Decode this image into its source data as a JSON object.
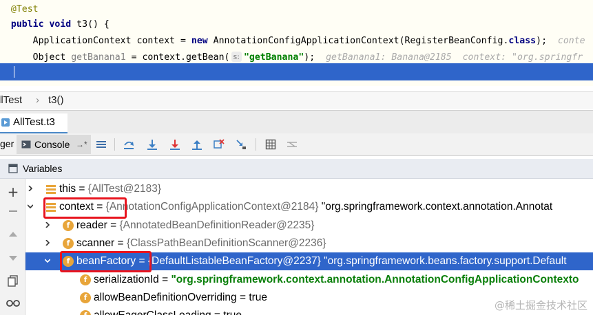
{
  "editor": {
    "line1": {
      "annotation": "@Test"
    },
    "line2": {
      "kw": "public",
      "kw2": "void",
      "rest": " t3() {"
    },
    "line3": {
      "type": "ApplicationContext",
      "var": " context = ",
      "kw_new": "new",
      "ctor": " AnnotationConfigApplicationContext(RegisterBeanConfig.",
      "kw_class": "class",
      "end": ");",
      "hint": "conte"
    },
    "line4": {
      "type": "Object",
      "var": "getBanana1",
      "mid": " = context.getBean(",
      "param_hint": "s:",
      "str": "\"getBanana\"",
      "end": ");",
      "hint1": "getBanana1: Banana@2185",
      "hint2": "context: \"org.springfr"
    }
  },
  "breadcrumb": {
    "class_name": "llTest",
    "separator": "›",
    "method": "t3()"
  },
  "debug_tab": {
    "label": "AllTest.t3"
  },
  "toolbar": {
    "debugger_label": "ger",
    "console_label": "Console",
    "console_arrow": "→*"
  },
  "variables": {
    "title": "Variables",
    "rows": [
      {
        "name": "this",
        "eq": " = ",
        "type": "{AllTest@2183}",
        "desc": ""
      },
      {
        "name": "context",
        "eq": " = ",
        "type": "{AnnotationConfigApplicationContext@2184}",
        "desc": " \"org.springframework.context.annotation.Annotat"
      },
      {
        "name": "reader",
        "eq": " = ",
        "type": "{AnnotatedBeanDefinitionReader@2235}",
        "desc": ""
      },
      {
        "name": "scanner",
        "eq": " = ",
        "type": "{ClassPathBeanDefinitionScanner@2236}",
        "desc": ""
      },
      {
        "name": "beanFactory",
        "eq": " = ",
        "type": "{DefaultListableBeanFactory@2237}",
        "desc": " \"org.springframework.beans.factory.support.Default"
      },
      {
        "name": "serializationId",
        "eq": " = ",
        "str": "\"org.springframework.context.annotation.AnnotationConfigApplicationContexto"
      },
      {
        "name": "allowBeanDefinitionOverriding",
        "eq": " = ",
        "val": "true"
      },
      {
        "name": "allowEagerClassLoading",
        "eq": " = ",
        "val": "true"
      }
    ],
    "field_badge": "f"
  },
  "watermark": "@稀土掘金技术社区",
  "colors": {
    "selection": "#2f65ca",
    "highlight_box": "#e8141e",
    "field_icon": "#e8a53a"
  }
}
